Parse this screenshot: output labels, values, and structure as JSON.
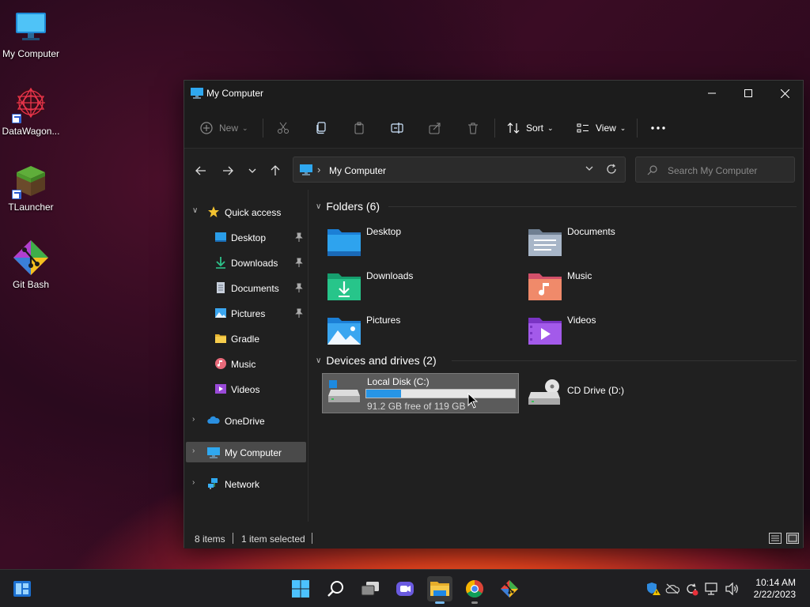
{
  "desktop": {
    "icons": [
      {
        "label": "My Computer"
      },
      {
        "label": "DataWagon..."
      },
      {
        "label": "TLauncher"
      },
      {
        "label": "Git Bash"
      }
    ]
  },
  "window": {
    "title": "My Computer",
    "controls": {
      "minimize": "minimize",
      "maximize": "maximize",
      "close": "close"
    }
  },
  "toolbar": {
    "new_label": "New",
    "sort_label": "Sort",
    "view_label": "View"
  },
  "address": {
    "path": "My Computer",
    "search_placeholder": "Search My Computer"
  },
  "nav": {
    "quick_access": "Quick access",
    "items": [
      {
        "label": "Desktop",
        "pinned": true
      },
      {
        "label": "Downloads",
        "pinned": true
      },
      {
        "label": "Documents",
        "pinned": true
      },
      {
        "label": "Pictures",
        "pinned": true
      },
      {
        "label": "Gradle",
        "pinned": false
      },
      {
        "label": "Music",
        "pinned": false
      },
      {
        "label": "Videos",
        "pinned": false
      }
    ],
    "onedrive": "OneDrive",
    "mycomputer": "My Computer",
    "network": "Network"
  },
  "content": {
    "folders_header": "Folders (6)",
    "folders": [
      {
        "name": "Desktop"
      },
      {
        "name": "Documents"
      },
      {
        "name": "Downloads"
      },
      {
        "name": "Music"
      },
      {
        "name": "Pictures"
      },
      {
        "name": "Videos"
      }
    ],
    "drives_header": "Devices and drives (2)",
    "drives": [
      {
        "name": "Local Disk (C:)",
        "free_text": "91.2 GB free of 119 GB",
        "used_fraction": 0.234
      },
      {
        "name": "CD Drive (D:)"
      }
    ]
  },
  "status": {
    "items": "8 items",
    "selected": "1 item selected"
  },
  "taskbar": {
    "time": "10:14 AM",
    "date": "2/22/2023"
  },
  "colors": {
    "accent": "#2795e6",
    "window_bg": "#202020",
    "selection": "#4a4a4a"
  }
}
